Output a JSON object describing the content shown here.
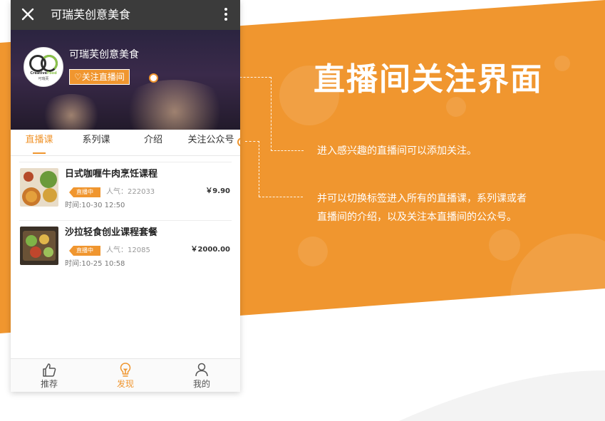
{
  "promo": {
    "title": "直播间关注界面",
    "desc_1": "进入感兴趣的直播间可以添加关注。",
    "desc_2_line1": "并可以切换标签进入所有的直播课，系列课或者",
    "desc_2_line2": "直播间的介绍，以及关注本直播间的公众号。"
  },
  "colors": {
    "accent": "#f0962f",
    "titlebar": "#3b3b3b",
    "background_band": "#f0962f"
  },
  "titlebar": {
    "close_icon": "close-icon",
    "title": "可瑞芙创意美食",
    "more_icon": "more-vertical-icon"
  },
  "hero": {
    "shop_name": "可瑞芙创意美食",
    "logo_text": "CreativeFood",
    "logo_sub": "可瑞芙",
    "follow_label": "♡关注直播间"
  },
  "tabs": [
    {
      "label": "直播课",
      "active": true
    },
    {
      "label": "系列课",
      "active": false
    },
    {
      "label": "介绍",
      "active": false
    },
    {
      "label": "关注公众号",
      "active": false
    }
  ],
  "courses": [
    {
      "title": "日式咖喱牛肉烹饪课程",
      "status": "直播中",
      "popularity": "人气：222033",
      "price": "￥9.90",
      "time": "时间:10-30 12:50"
    },
    {
      "title": "沙拉轻食创业课程套餐",
      "status": "直播中",
      "popularity": "人气：12085",
      "price": "￥2000.00",
      "time": "时间:10-25 10:58"
    }
  ],
  "bottom_nav": [
    {
      "label": "推荐",
      "icon": "thumbs-up-icon",
      "active": false
    },
    {
      "label": "发现",
      "icon": "lightbulb-icon",
      "active": true
    },
    {
      "label": "我的",
      "icon": "user-icon",
      "active": false
    }
  ]
}
